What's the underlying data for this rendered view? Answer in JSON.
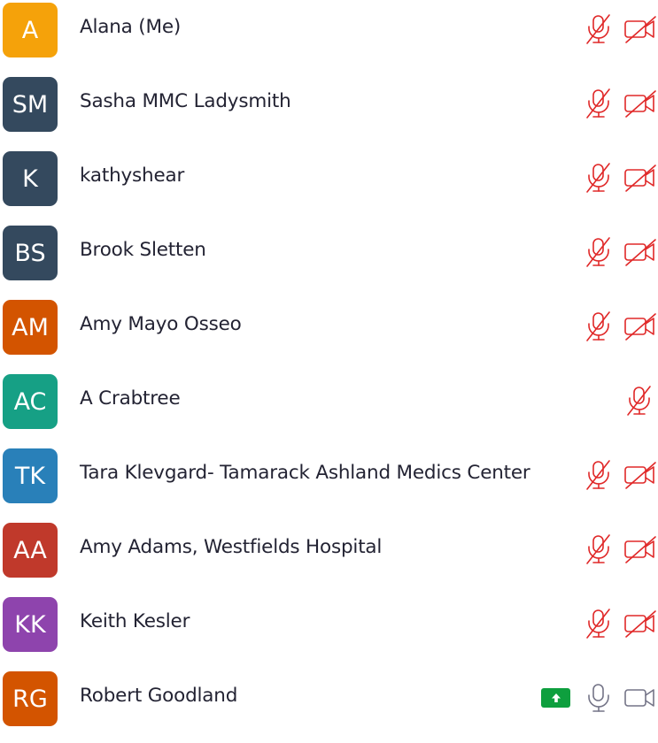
{
  "participants": [
    {
      "initials": "A",
      "name": "Alana (Me)",
      "color": "#f5a20a",
      "mic": "muted",
      "video": "off",
      "sharing": false
    },
    {
      "initials": "SM",
      "name": "Sasha MMC Ladysmith",
      "color": "#34495e",
      "mic": "muted",
      "video": "off",
      "sharing": false
    },
    {
      "initials": "K",
      "name": "kathyshear",
      "color": "#34495e",
      "mic": "muted",
      "video": "off",
      "sharing": false
    },
    {
      "initials": "BS",
      "name": "Brook Sletten",
      "color": "#34495e",
      "mic": "muted",
      "video": "off",
      "sharing": false
    },
    {
      "initials": "AM",
      "name": "Amy Mayo Osseo",
      "color": "#d35400",
      "mic": "muted",
      "video": "off",
      "sharing": false
    },
    {
      "initials": "AC",
      "name": "A Crabtree",
      "color": "#16a085",
      "mic": "muted",
      "video": "none",
      "sharing": false
    },
    {
      "initials": "TK",
      "name": "Tara Klevgard- Tamarack Ashland Medics Center",
      "color": "#2980b9",
      "mic": "muted",
      "video": "off",
      "sharing": false
    },
    {
      "initials": "AA",
      "name": "Amy Adams, Westfields Hospital",
      "color": "#c0392b",
      "mic": "muted",
      "video": "off",
      "sharing": false
    },
    {
      "initials": "KK",
      "name": "Keith Kesler",
      "color": "#8e44ad",
      "mic": "muted",
      "video": "off",
      "sharing": false
    },
    {
      "initials": "RG",
      "name": "Robert Goodland",
      "color": "#d35400",
      "mic": "on",
      "video": "on",
      "sharing": true
    }
  ],
  "icons": {
    "mic_muted": "microphone-muted-icon",
    "video_off": "video-off-icon",
    "mic_on": "microphone-icon",
    "video_on": "video-icon",
    "share": "screen-share-arrow-icon"
  },
  "colors": {
    "muted_red": "#e02828",
    "neutral_gray": "#747487",
    "share_green": "#0e9f3e"
  }
}
